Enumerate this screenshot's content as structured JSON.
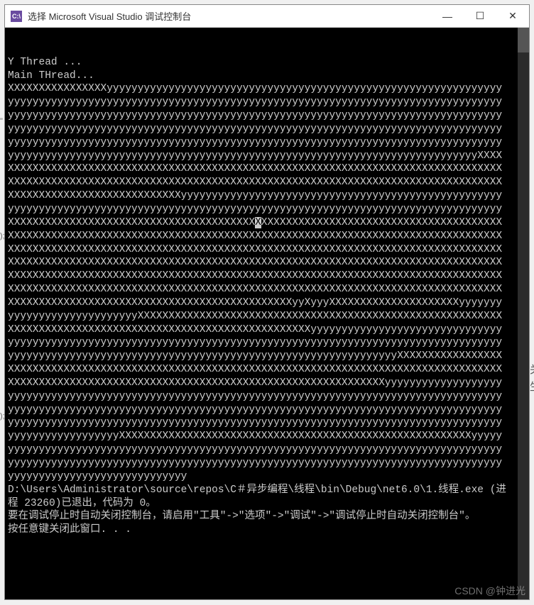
{
  "titlebar": {
    "icon_text": "C:\\",
    "title": "选择 Microsoft Visual Studio 调试控制台",
    "minimize": "—",
    "maximize": "☐",
    "close": "✕"
  },
  "console": {
    "lines": [
      "Y Thread ...",
      "Main THread...",
      "XXXXXXXXXXXXXXXXyyyyyyyyyyyyyyyyyyyyyyyyyyyyyyyyyyyyyyyyyyyyyyyyyyyyyyyyyyyyyyyy",
      "yyyyyyyyyyyyyyyyyyyyyyyyyyyyyyyyyyyyyyyyyyyyyyyyyyyyyyyyyyyyyyyyyyyyyyyyyyyyyyyy",
      "yyyyyyyyyyyyyyyyyyyyyyyyyyyyyyyyyyyyyyyyyyyyyyyyyyyyyyyyyyyyyyyyyyyyyyyyyyyyyyyy",
      "yyyyyyyyyyyyyyyyyyyyyyyyyyyyyyyyyyyyyyyyyyyyyyyyyyyyyyyyyyyyyyyyyyyyyyyyyyyyyyyy",
      "yyyyyyyyyyyyyyyyyyyyyyyyyyyyyyyyyyyyyyyyyyyyyyyyyyyyyyyyyyyyyyyyyyyyyyyyyyyyyyyy",
      "yyyyyyyyyyyyyyyyyyyyyyyyyyyyyyyyyyyyyyyyyyyyyyyyyyyyyyyyyyyyyyyyyyyyyyyyyyyyXXXX",
      "XXXXXXXXXXXXXXXXXXXXXXXXXXXXXXXXXXXXXXXXXXXXXXXXXXXXXXXXXXXXXXXXXXXXXXXXXXXXXXXX",
      "XXXXXXXXXXXXXXXXXXXXXXXXXXXXXXXXXXXXXXXXXXXXXXXXXXXXXXXXXXXXXXXXXXXXXXXXXXXXXXXX",
      "XXXXXXXXXXXXXXXXXXXXXXXXXXXXyyyyyyyyyyyyyyyyyyyyyyyyyyyyyyyyyyyyyyyyyyyyyyyyyyyy",
      "yyyyyyyyyyyyyyyyyyyyyyyyyyyyyyyyyyyyyyyyyyyyyyyyyyyyyyyyyyyyyyyyyyyyyyyyyyyyyyyy",
      "XXXXXXXXXXXXXXXXXXXXXXXXXXXXXXXXXXXXXXXXXXXXXXXXXXXXXXXXXXXXXXXXXXXXXXXXXXXXXXXX",
      "XXXXXXXXXXXXXXXXXXXXXXXXXXXXXXXXXXXXXXXXXXXXXXXXXXXXXXXXXXXXXXXXXXXXXXXXXXXXXXXX",
      "XXXXXXXXXXXXXXXXXXXXXXXXXXXXXXXXXXXXXXXXXXXXXXXXXXXXXXXXXXXXXXXXXXXXXXXXXXXXXXXX",
      "XXXXXXXXXXXXXXXXXXXXXXXXXXXXXXXXXXXXXXXXXXXXXXXXXXXXXXXXXXXXXXXXXXXXXXXXXXXXXXXX",
      "XXXXXXXXXXXXXXXXXXXXXXXXXXXXXXXXXXXXXXXXXXXXXXXXXXXXXXXXXXXXXXXXXXXXXXXXXXXXXXXX",
      "XXXXXXXXXXXXXXXXXXXXXXXXXXXXXXXXXXXXXXXXXXXXXXXXXXXXXXXXXXXXXXXXXXXXXXXXXXXXXXXX",
      "XXXXXXXXXXXXXXXXXXXXXXXXXXXXXXXXXXXXXXXXXXXXXXyyXyyyXXXXXXXXXXXXXXXXXXXXXyyyyyyy",
      "yyyyyyyyyyyyyyyyyyyyyXXXXXXXXXXXXXXXXXXXXXXXXXXXXXXXXXXXXXXXXXXXXXXXXXXXXXXXXXXX",
      "XXXXXXXXXXXXXXXXXXXXXXXXXXXXXXXXXXXXXXXXXXXXXXXXXyyyyyyyyyyyyyyyyyyyyyyyyyyyyyyy",
      "yyyyyyyyyyyyyyyyyyyyyyyyyyyyyyyyyyyyyyyyyyyyyyyyyyyyyyyyyyyyyyyyyyyyyyyyyyyyyyyy",
      "yyyyyyyyyyyyyyyyyyyyyyyyyyyyyyyyyyyyyyyyyyyyyyyyyyyyyyyyyyyyyyyXXXXXXXXXXXXXXXXX",
      "XXXXXXXXXXXXXXXXXXXXXXXXXXXXXXXXXXXXXXXXXXXXXXXXXXXXXXXXXXXXXXXXXXXXXXXXXXXXXXXX",
      "XXXXXXXXXXXXXXXXXXXXXXXXXXXXXXXXXXXXXXXXXXXXXXXXXXXXXXXXXXXXXyyyyyyyyyyyyyyyyyyy",
      "yyyyyyyyyyyyyyyyyyyyyyyyyyyyyyyyyyyyyyyyyyyyyyyyyyyyyyyyyyyyyyyyyyyyyyyyyyyyyyyy",
      "yyyyyyyyyyyyyyyyyyyyyyyyyyyyyyyyyyyyyyyyyyyyyyyyyyyyyyyyyyyyyyyyyyyyyyyyyyyyyyyy",
      "yyyyyyyyyyyyyyyyyyyyyyyyyyyyyyyyyyyyyyyyyyyyyyyyyyyyyyyyyyyyyyyyyyyyyyyyyyyyyyyy",
      "yyyyyyyyyyyyyyyyyyXXXXXXXXXXXXXXXXXXXXXXXXXXXXXXXXXXXXXXXXXXXXXXXXXXXXXXXXXyyyyy",
      "yyyyyyyyyyyyyyyyyyyyyyyyyyyyyyyyyyyyyyyyyyyyyyyyyyyyyyyyyyyyyyyyyyyyyyyyyyyyyyyy",
      "yyyyyyyyyyyyyyyyyyyyyyyyyyyyyyyyyyyyyyyyyyyyyyyyyyyyyyyyyyyyyyyyyyyyyyyyyyyyyyyy",
      "yyyyyyyyyyyyyyyyyyyyyyyyyyyyy",
      "D:\\Users\\Administrator\\source\\repos\\C＃异步编程\\线程\\bin\\Debug\\net6.0\\1.线程.exe (进程 23260)已退出，代码为 0。",
      "要在调试停止时自动关闭控制台，请启用\"工具\"->\"选项\"->\"调试\"->\"调试停止时自动关闭控制台\"。",
      "按任意键关闭此窗口. . ."
    ],
    "cursor_line_index": 12,
    "cursor_col": 40
  },
  "watermark": "CSDN @钟进光",
  "side_text": "关\n生"
}
